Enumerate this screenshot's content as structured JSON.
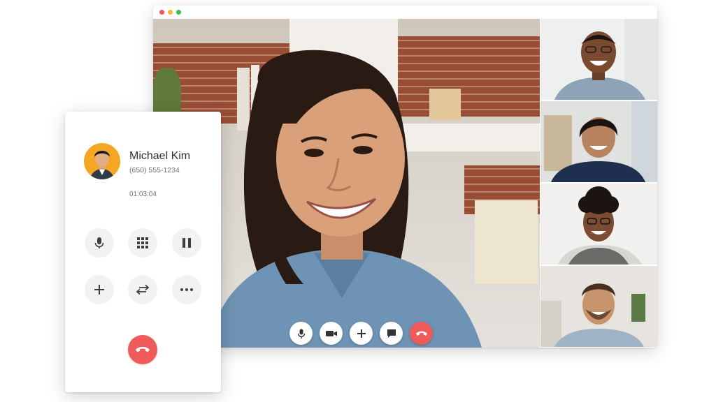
{
  "window": {
    "traffic_lights": [
      "red",
      "yellow",
      "green"
    ]
  },
  "phone_call": {
    "caller_name": "Michael Kim",
    "caller_number": "(650) 555-1234",
    "call_duration": "01:03:04",
    "controls": [
      {
        "name": "mute",
        "icon": "microphone-icon"
      },
      {
        "name": "keypad",
        "icon": "keypad-grid-icon"
      },
      {
        "name": "hold",
        "icon": "pause-icon"
      },
      {
        "name": "add-call",
        "icon": "plus-icon"
      },
      {
        "name": "transfer",
        "icon": "transfer-arrows-icon"
      },
      {
        "name": "more",
        "icon": "more-dots-icon"
      },
      {
        "name": "end-call",
        "icon": "phone-hangup-icon"
      }
    ]
  },
  "video_call": {
    "participants_count": 5,
    "controls": [
      {
        "name": "mute",
        "icon": "microphone-icon"
      },
      {
        "name": "camera",
        "icon": "video-camera-icon"
      },
      {
        "name": "add-participant",
        "icon": "plus-icon"
      },
      {
        "name": "chat",
        "icon": "chat-bubble-icon"
      },
      {
        "name": "end-call",
        "icon": "phone-hangup-icon"
      }
    ]
  },
  "colors": {
    "end_call": "#ef5a5a",
    "avatar_bg": "#f5a623",
    "button_bg": "#f2f2f3",
    "traffic_red": "#ef5656",
    "traffic_yellow": "#f5b82e",
    "traffic_green": "#39c24a"
  }
}
